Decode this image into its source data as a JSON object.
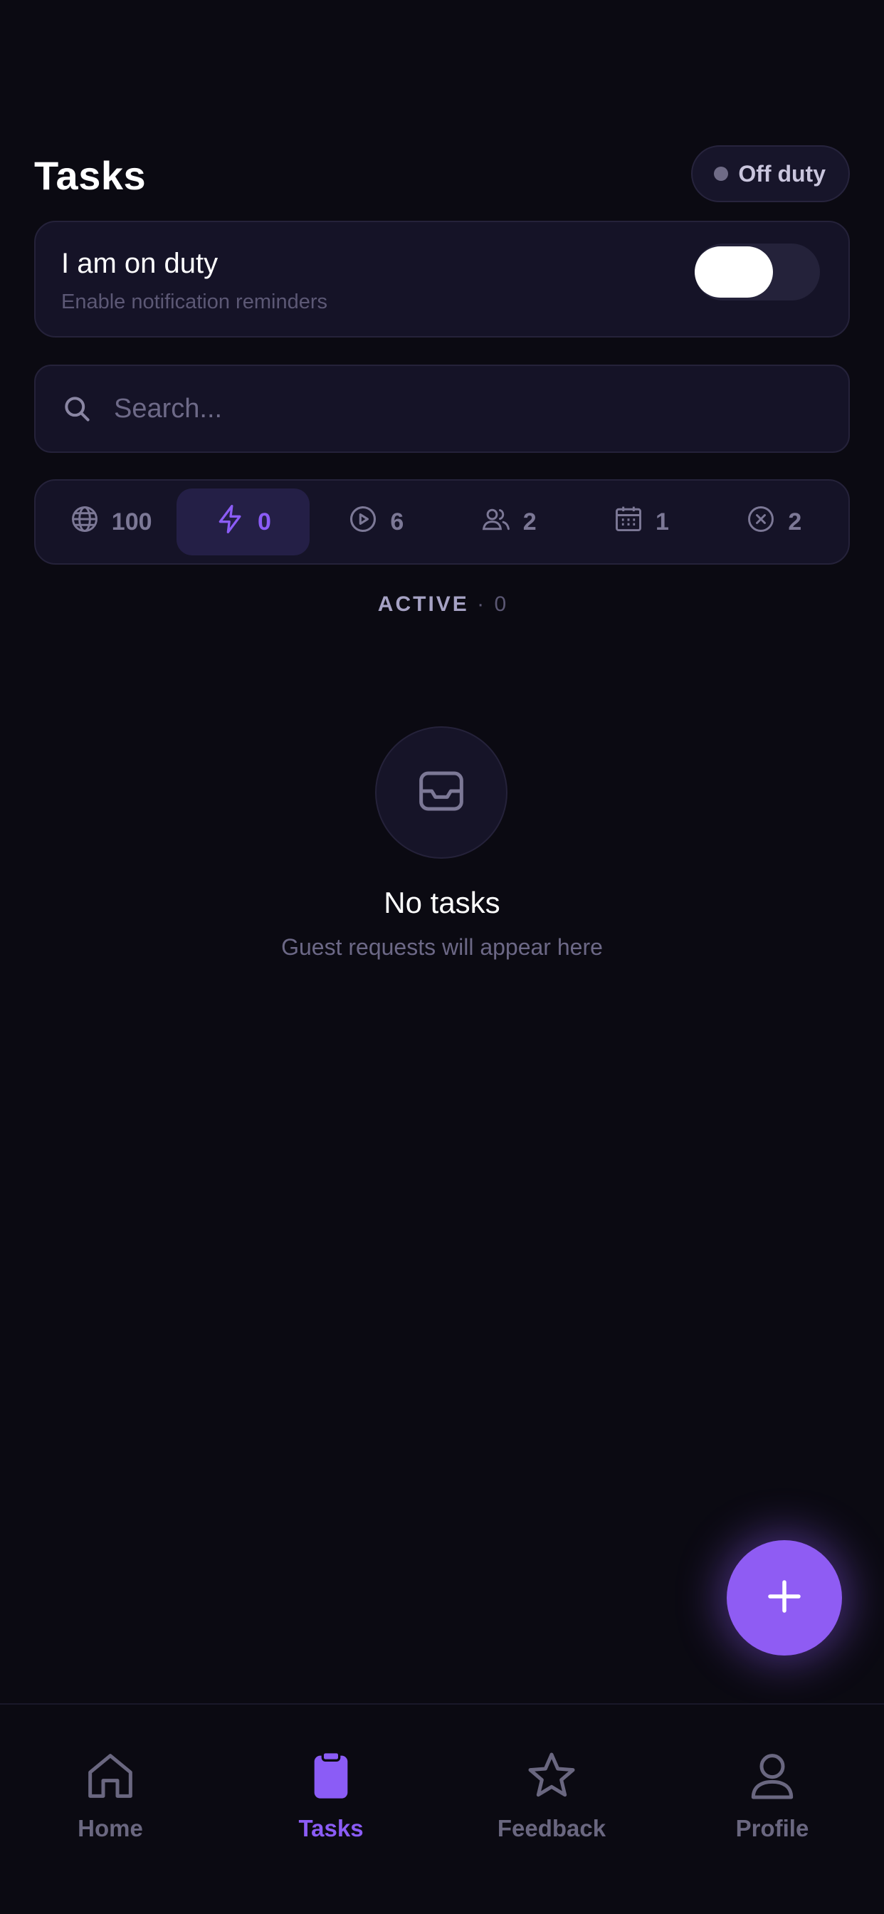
{
  "header": {
    "title": "Tasks",
    "duty_status": "Off duty"
  },
  "duty_card": {
    "title": "I am on duty",
    "subtitle": "Enable notification reminders",
    "toggle_on": false
  },
  "search": {
    "placeholder": "Search...",
    "value": ""
  },
  "filters": [
    {
      "icon": "globe-icon",
      "count": "100",
      "active": false
    },
    {
      "icon": "lightning-icon",
      "count": "0",
      "active": true
    },
    {
      "icon": "play-circle-icon",
      "count": "6",
      "active": false
    },
    {
      "icon": "users-icon",
      "count": "2",
      "active": false
    },
    {
      "icon": "calendar-icon",
      "count": "1",
      "active": false
    },
    {
      "icon": "x-circle-icon",
      "count": "2",
      "active": false
    }
  ],
  "section": {
    "name": "ACTIVE",
    "separator": "·",
    "count": "0"
  },
  "empty_state": {
    "icon": "inbox-icon",
    "title": "No tasks",
    "subtitle": "Guest requests will appear here"
  },
  "fab": {
    "icon": "plus-icon"
  },
  "nav": [
    {
      "label": "Home",
      "icon": "home-icon",
      "active": false
    },
    {
      "label": "Tasks",
      "icon": "clipboard-icon",
      "active": true
    },
    {
      "label": "Feedback",
      "icon": "star-icon",
      "active": false
    },
    {
      "label": "Profile",
      "icon": "user-icon",
      "active": false
    }
  ],
  "colors": {
    "background": "#0b0a12",
    "card": "#151327",
    "accent": "#8b5cf6",
    "muted_text": "#6a6780"
  }
}
